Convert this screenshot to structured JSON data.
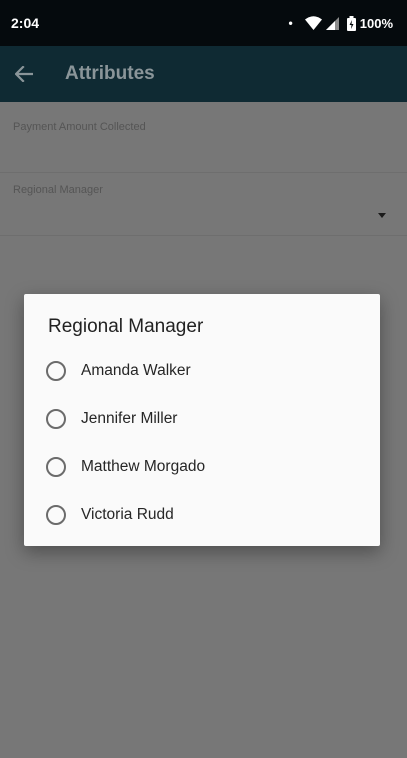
{
  "status_bar": {
    "time": "2:04",
    "dot": "•",
    "battery_text": "100%",
    "icons": [
      "notification-dot-icon",
      "wifi-icon",
      "signal-icon",
      "battery-icon"
    ]
  },
  "app_bar": {
    "title": "Attributes",
    "back_icon": "arrow-back-icon",
    "background": "#0f2a33"
  },
  "form": {
    "fields": [
      {
        "label": "Payment Amount Collected",
        "value": ""
      },
      {
        "label": "Regional Manager",
        "value": ""
      }
    ]
  },
  "dialog": {
    "title": "Regional Manager",
    "options": [
      "Amanda Walker",
      "Jennifer Miller",
      "Matthew Morgado",
      "Victoria Rudd"
    ],
    "selected": null
  }
}
